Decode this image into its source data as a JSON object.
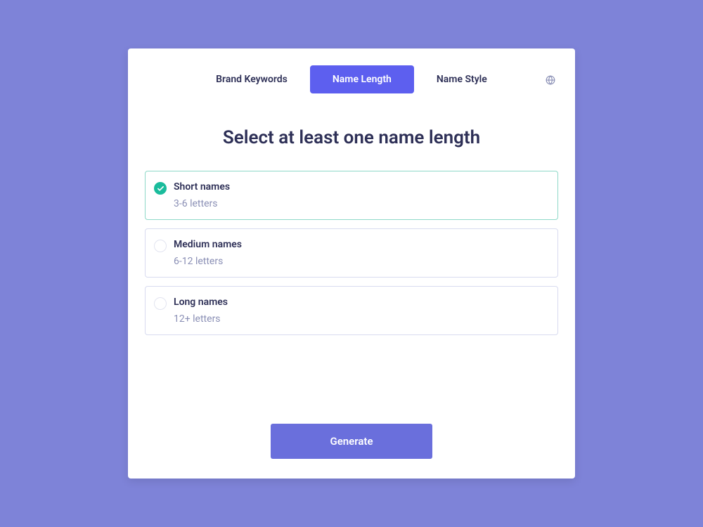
{
  "tabs": [
    {
      "label": "Brand Keywords",
      "active": false
    },
    {
      "label": "Name Length",
      "active": true
    },
    {
      "label": "Name Style",
      "active": false
    }
  ],
  "title": "Select at least one name length",
  "options": [
    {
      "label": "Short names",
      "desc": "3-6 letters",
      "selected": true
    },
    {
      "label": "Medium names",
      "desc": "6-12 letters",
      "selected": false
    },
    {
      "label": "Long names",
      "desc": "12+ letters",
      "selected": false
    }
  ],
  "generate_label": "Generate"
}
